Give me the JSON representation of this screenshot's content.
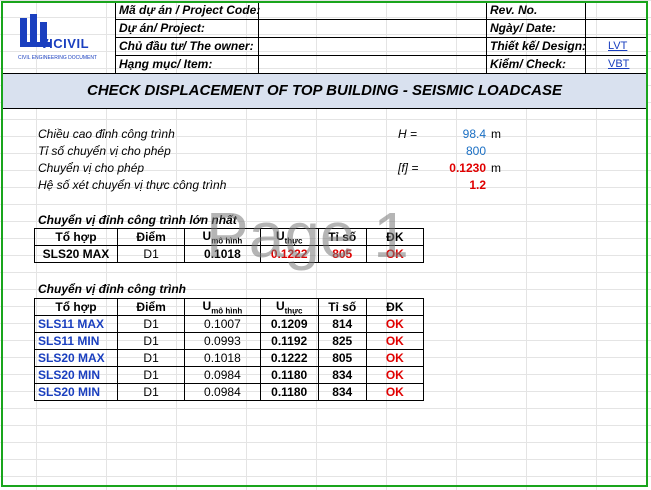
{
  "header": {
    "logo_text": "VICIVIL",
    "logo_sub": "CIVIL ENGINEERING DOCUMENT",
    "project_code_label": "Mã dự án / Project Code:",
    "project_label": "Dự án/ Project:",
    "owner_label": "Chủ đầu tư/ The owner:",
    "item_label": "Hạng mục/ Item:",
    "rev_label": "Rev. No.",
    "date_label": "Ngày/ Date:",
    "design_label": "Thiết kế/ Design:",
    "design_value": "LVT",
    "check_label": "Kiểm/ Check:",
    "check_value": "VBT",
    "accent_color": "#1a3fbf",
    "frame_color": "#19a51c"
  },
  "title": "CHECK DISPLACEMENT OF TOP BUILDING -  SEISMIC LOADCASE",
  "params": [
    {
      "label": "Chiều cao đỉnh công trình",
      "symbol": "H =",
      "value": "98.4",
      "unit": "m",
      "color": "#1a6fc4"
    },
    {
      "label": "Tỉ số chuyển vị cho phép",
      "symbol": "",
      "value": "800",
      "unit": "",
      "color": "#1a6fc4"
    },
    {
      "label": "Chuyển vị cho phép",
      "symbol": "[f] =",
      "value": "0.1230",
      "unit": "m",
      "color": "#e00000"
    },
    {
      "label": "Hệ số xét chuyển vị thực công trình",
      "symbol": "",
      "value": "1.2",
      "unit": "",
      "color": "#e00000"
    }
  ],
  "section1_title": "Chuyển vị đỉnh công trình lớn nhất",
  "section2_title": "Chuyển vị đỉnh công trình",
  "table_headers": {
    "combo": "Tổ hợp",
    "point": "Điểm",
    "u_model": "U",
    "u_model_sub": "mô hình",
    "u_real": "U",
    "u_real_sub": "thực",
    "ratio": "Tỉ số",
    "check": "ĐK"
  },
  "max_row": {
    "combo": "SLS20 MAX",
    "point": "D1",
    "u_model": "0.1018",
    "u_real": "0.1222",
    "ratio": "805",
    "check": "OK"
  },
  "rows": [
    {
      "combo": "SLS11 MAX",
      "point": "D1",
      "u_model": "0.1007",
      "u_real": "0.1209",
      "ratio": "814",
      "check": "OK"
    },
    {
      "combo": "SLS11 MIN",
      "point": "D1",
      "u_model": "0.0993",
      "u_real": "0.1192",
      "ratio": "825",
      "check": "OK"
    },
    {
      "combo": "SLS20 MAX",
      "point": "D1",
      "u_model": "0.1018",
      "u_real": "0.1222",
      "ratio": "805",
      "check": "OK"
    },
    {
      "combo": "SLS20 MIN",
      "point": "D1",
      "u_model": "0.0984",
      "u_real": "0.1180",
      "ratio": "834",
      "check": "OK"
    },
    {
      "combo": "SLS20 MIN",
      "point": "D1",
      "u_model": "0.0984",
      "u_real": "0.1180",
      "ratio": "834",
      "check": "OK"
    }
  ],
  "watermark": "Page 1"
}
